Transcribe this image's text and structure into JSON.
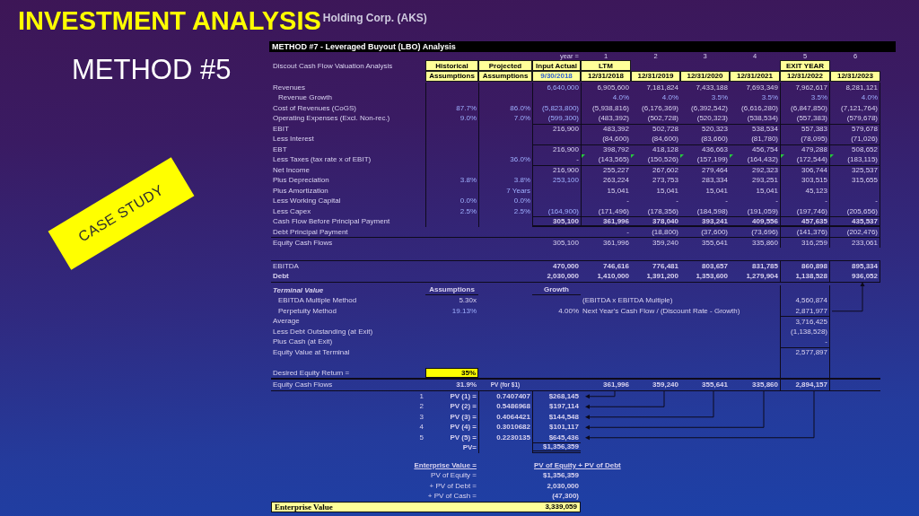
{
  "slide": {
    "title": "INVESTMENT ANALYSIS",
    "subtitle": "METHOD #5",
    "banner": "CASE STUDY"
  },
  "sheet": {
    "company": "Holding Corp. (AKS)",
    "title": "METHOD #7 - Leveraged Buyout (LBO) Analysis",
    "year_label": "year =",
    "years": [
      "1",
      "2",
      "3",
      "4",
      "5",
      "6"
    ],
    "section_label": "Discout Cash Flow Valuation Analysis",
    "columns": [
      {
        "top": "Historical",
        "bottom": "Assumptions",
        "date_input": false
      },
      {
        "top": "Projected",
        "bottom": "Assumptions",
        "date_input": false
      },
      {
        "top": "Input Actual",
        "bottom": "9/30/2018",
        "date_input": true
      },
      {
        "top": "LTM",
        "bottom": "12/31/2018",
        "date_input": false
      },
      {
        "bottom": "12/31/2019",
        "date_input": false
      },
      {
        "bottom": "12/31/2020",
        "date_input": false
      },
      {
        "bottom": "12/31/2021",
        "date_input": false
      },
      {
        "top": "EXIT YEAR",
        "bottom": "12/31/2022",
        "date_input": false
      },
      {
        "bottom": "12/31/2023",
        "date_input": false
      }
    ],
    "rows": [
      {
        "label": "Revenues",
        "kind": "input",
        "actual": "6,640,000",
        "periods": [
          "6,905,600",
          "7,181,824",
          "7,433,188",
          "7,693,349",
          "7,962,617",
          "8,281,121"
        ]
      },
      {
        "label": "Revenue Growth",
        "kind": "growth",
        "periods": [
          "4.0%",
          "4.0%",
          "3.5%",
          "3.5%",
          "3.5%",
          "4.0%"
        ]
      },
      {
        "label": "Cost of Revenues (CoGS)",
        "kind": "input",
        "historical": "87.7%",
        "projected": "86.0%",
        "actual": "(5,823,800)",
        "periods": [
          "(5,938,816)",
          "(6,176,369)",
          "(6,392,542)",
          "(6,616,280)",
          "(6,847,850)",
          "(7,121,764)"
        ]
      },
      {
        "label": "Operating Expenses (Excl. Non-rec.)",
        "kind": "input",
        "historical": "9.0%",
        "projected": "7.0%",
        "actual": "(599,300)",
        "periods": [
          "(483,392)",
          "(502,728)",
          "(520,323)",
          "(538,534)",
          "(557,383)",
          "(579,678)"
        ]
      },
      {
        "label": "EBIT",
        "kind": "subtotal",
        "actual": "216,900",
        "periods": [
          "483,392",
          "502,728",
          "520,323",
          "538,534",
          "557,383",
          "579,678"
        ]
      },
      {
        "label": "Less Interest",
        "kind": "line",
        "periods": [
          "(84,600)",
          "(84,600)",
          "(83,660)",
          "(81,780)",
          "(78,095)",
          "(71,026)"
        ]
      },
      {
        "label": "EBT",
        "kind": "subtotal",
        "actual": "216,900",
        "periods": [
          "398,792",
          "418,128",
          "436,663",
          "456,754",
          "479,288",
          "508,652"
        ]
      },
      {
        "label": "Less Taxes (tax rate x of EBIT)",
        "kind": "line",
        "projected": "36.0%",
        "actual": "-",
        "periods": [
          "(143,565)",
          "(150,526)",
          "(157,199)",
          "(164,432)",
          "(172,544)",
          "(183,115)"
        ],
        "flagged": true
      },
      {
        "label": "Net Income",
        "kind": "subtotal",
        "actual": "216,900",
        "periods": [
          "255,227",
          "267,602",
          "279,464",
          "292,323",
          "306,744",
          "325,537"
        ]
      },
      {
        "label": "Plus Depreciation",
        "kind": "input",
        "historical": "3.8%",
        "projected": "3.8%",
        "actual": "253,100",
        "periods": [
          "263,224",
          "273,753",
          "283,334",
          "293,251",
          "303,515",
          "315,655"
        ]
      },
      {
        "label": "Plus Amortization",
        "kind": "line",
        "projected": "7 Years",
        "periods": [
          "15,041",
          "15,041",
          "15,041",
          "15,041",
          "45,123"
        ]
      },
      {
        "label": "Less Working Capital",
        "kind": "line",
        "historical": "0.0%",
        "projected": "0.0%",
        "periods": [
          "-",
          "-",
          "-",
          "-",
          "-",
          "-"
        ]
      },
      {
        "label": "Less Capex",
        "kind": "input",
        "historical": "2.5%",
        "projected": "2.5%",
        "actual": "(164,900)",
        "periods": [
          "(171,496)",
          "(178,356)",
          "(184,598)",
          "(191,059)",
          "(197,746)",
          "(205,656)"
        ]
      },
      {
        "label": "Cash Flow Before Principal Payment",
        "kind": "total",
        "actual": "305,100",
        "periods": [
          "361,996",
          "378,040",
          "393,241",
          "409,556",
          "457,635",
          "435,537"
        ]
      },
      {
        "label": "Debt Principal Payment",
        "kind": "line",
        "periods": [
          "-",
          "(18,800)",
          "(37,600)",
          "(73,696)",
          "(141,376)",
          "(202,476)"
        ]
      },
      {
        "label": "Equity Cash Flows",
        "kind": "result",
        "actual": "305,100",
        "periods": [
          "361,996",
          "359,240",
          "355,641",
          "335,860",
          "316,259",
          "233,061"
        ]
      }
    ],
    "metrics": [
      {
        "label": "EBITDA",
        "emphasis": false,
        "actual": "470,000",
        "periods": [
          "746,616",
          "776,481",
          "803,657",
          "831,785",
          "860,898",
          "895,334"
        ]
      },
      {
        "label": "Debt",
        "emphasis": true,
        "actual": "2,030,000",
        "periods": [
          "1,410,000",
          "1,391,200",
          "1,353,600",
          "1,279,904",
          "1,138,528",
          "936,052"
        ]
      }
    ],
    "terminal": {
      "heading": "Terminal Value",
      "assumptions_heading": "Assumptions",
      "growth_heading": "Growth",
      "rows": [
        {
          "label": "EBITDA Multiple Method",
          "kind": "method",
          "assumption": "5.30x",
          "assumption_input": false,
          "note": "(EBITDA x EBITDA Multiple)",
          "value": "4,560,874"
        },
        {
          "label": "Perpetuity Method",
          "kind": "method",
          "assumption": "19.13%",
          "assumption_input": true,
          "growth": "4.00%",
          "note": "Next Year's Cash Flow / (Discount Rate - Growth)",
          "value": "2,871,977"
        },
        {
          "label": "Average",
          "kind": "subtotal",
          "value": "3,716,425"
        },
        {
          "label": "Less Debt Outstanding (at Exit)",
          "kind": "line",
          "value": "(1,138,528)"
        },
        {
          "label": "Plus Cash (at Exit)",
          "kind": "line",
          "value": "-"
        },
        {
          "label": "Equity Value at Terminal",
          "kind": "subtotal",
          "value": "2,577,897"
        }
      ]
    },
    "desired_return": {
      "label": "Desired Equity Return =",
      "value": "35%"
    },
    "equity_cash_flows": {
      "label": "Equity Cash Flows",
      "rate": "31.9%",
      "factor_heading": "PV (for $1)",
      "values": [
        "361,996",
        "359,240",
        "355,641",
        "335,860",
        "2,894,157"
      ]
    },
    "present_values": [
      {
        "n": "1",
        "label": "PV (1) =",
        "factor": "0.7407407",
        "value": "$268,145"
      },
      {
        "n": "2",
        "label": "PV (2) =",
        "factor": "0.5486968",
        "value": "$197,114"
      },
      {
        "n": "3",
        "label": "PV (3) =",
        "factor": "0.4064421",
        "value": "$144,548"
      },
      {
        "n": "4",
        "label": "PV (4) =",
        "factor": "0.3010682",
        "value": "$101,117"
      },
      {
        "n": "5",
        "label": "PV (5) =",
        "factor": "0.2230135",
        "value": "$645,436"
      }
    ],
    "pv_total": {
      "label": "PV=",
      "value": "$1,356,359"
    },
    "enterprise": {
      "heading": "Enterprise Value =",
      "formula": "PV of Equity + PV of Debt",
      "rows": [
        {
          "label": "PV of Equity =",
          "value": "$1,356,359"
        },
        {
          "label": "+ PV of Debt =",
          "value": "2,030,000"
        },
        {
          "label": "+ PV of Cash =",
          "value": "(47,300)"
        }
      ],
      "total": {
        "label": "Enterprise Value",
        "value": "3,339,059"
      }
    }
  }
}
